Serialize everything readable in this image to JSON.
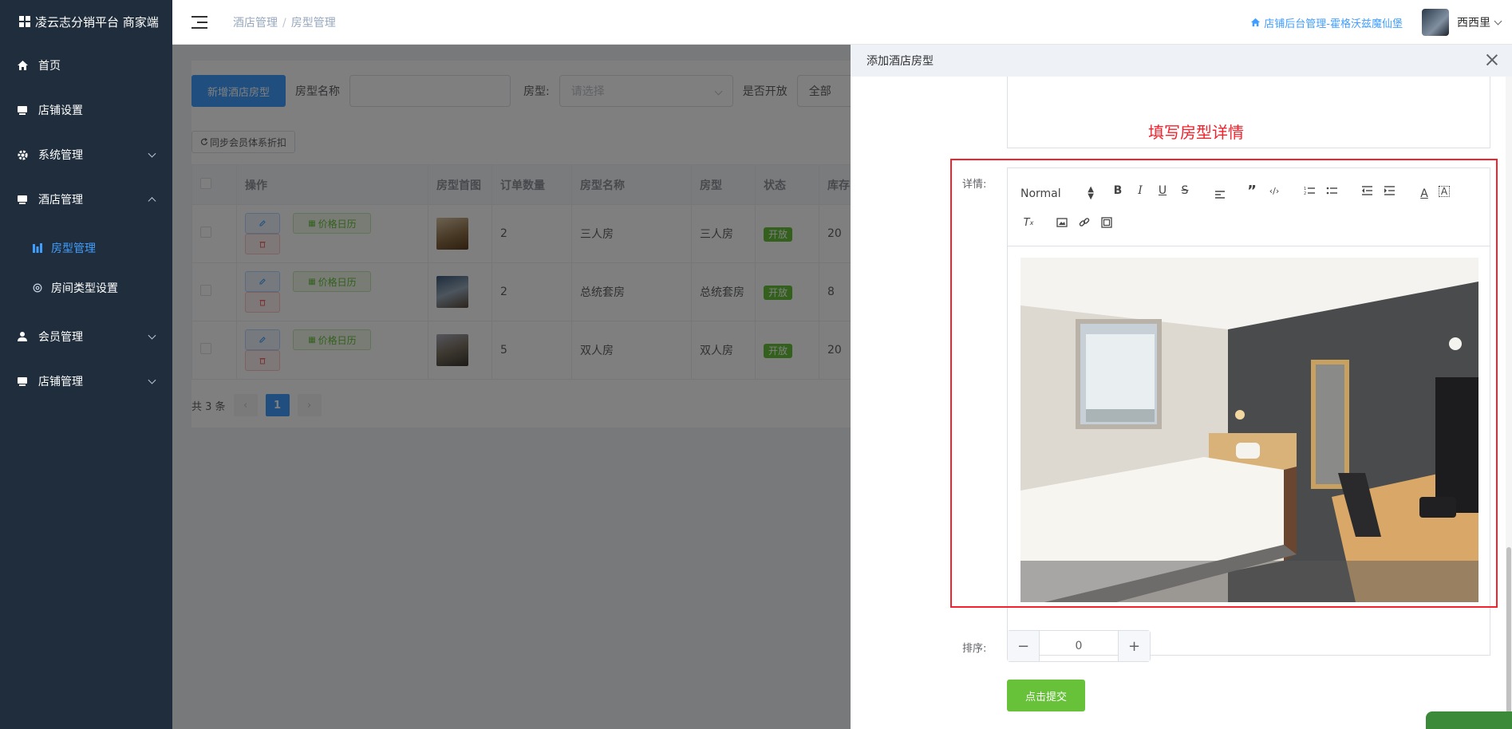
{
  "sidebar": {
    "brand": "凌云志分销平台 商家端",
    "items": [
      {
        "label": "首页",
        "icon": "home-icon"
      },
      {
        "label": "店铺设置",
        "icon": "store-icon"
      },
      {
        "label": "系统管理",
        "icon": "gear-icon"
      },
      {
        "label": "酒店管理",
        "icon": "hotel-icon"
      },
      {
        "label": "会员管理",
        "icon": "user-icon"
      },
      {
        "label": "店铺管理",
        "icon": "store-icon"
      }
    ],
    "sub_items": [
      {
        "label": "房型管理",
        "icon": "chart-icon"
      },
      {
        "label": "房间类型设置",
        "icon": "gear-icon"
      }
    ]
  },
  "header": {
    "breadcrumb": [
      "酒店管理",
      "房型管理"
    ],
    "store_link": "店铺后台管理-霍格沃兹魔仙堡",
    "user_name": "西西里"
  },
  "toolbar": {
    "add_button": "新增酒店房型",
    "name_label": "房型名称",
    "type_label": "房型:",
    "type_placeholder": "请选择",
    "open_label": "是否开放",
    "open_value": "全部",
    "sync_button": "同步会员体系折扣"
  },
  "table": {
    "headers": [
      "操作",
      "房型首图",
      "订单数量",
      "房型名称",
      "房型",
      "状态",
      "库存"
    ],
    "calendar_label": "价格日历",
    "rows": [
      {
        "orders": "2",
        "name": "三人房",
        "type": "三人房",
        "status": "开放",
        "stock": "20"
      },
      {
        "orders": "2",
        "name": "总统套房",
        "type": "总统套房",
        "status": "开放",
        "stock": "8"
      },
      {
        "orders": "5",
        "name": "双人房",
        "type": "双人房",
        "status": "开放",
        "stock": "20"
      }
    ]
  },
  "pagination": {
    "total": "共 3 条",
    "current": "1"
  },
  "drawer": {
    "title": "添加酒店房型",
    "annotation": "填写房型详情",
    "detail_label": "详情:",
    "format_select": "Normal",
    "sort_label": "排序:",
    "sort_value": "0",
    "submit": "点击提交"
  },
  "colors": {
    "sidebar_bg": "#1f2d3d",
    "primary": "#409eff",
    "success": "#67c23a",
    "danger": "#f5222d"
  }
}
